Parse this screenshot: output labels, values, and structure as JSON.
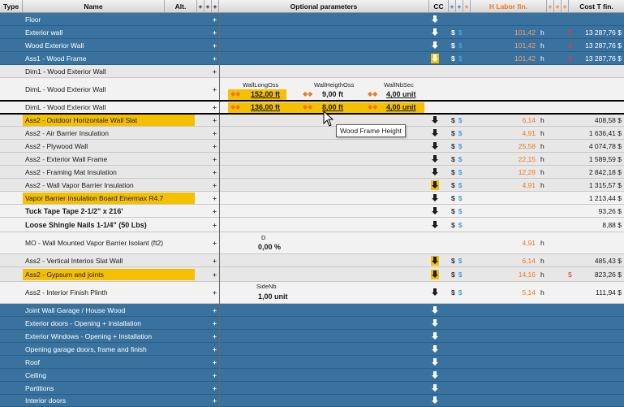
{
  "columns": {
    "type": "Type",
    "name": "Name",
    "alt": "Alt.",
    "plus": "+",
    "optional": "Optional parameters",
    "cc": "CC",
    "h_labor": "H Labor fin.",
    "cost": "Cost T fin."
  },
  "rows": [
    {
      "name": "Floor",
      "style": "blue",
      "plus": "+",
      "cc": true
    },
    {
      "name": "Exterior wall",
      "style": "blue",
      "plus": "+",
      "cc": true,
      "money": "$",
      "money2": "$",
      "h": "101,42",
      "hunit": "h",
      "dol": "$",
      "cost": "13 287,76 $"
    },
    {
      "name": "Wood Exterior Wall",
      "style": "blue",
      "plus": "+",
      "cc": true,
      "money": "$",
      "money2": "$",
      "h": "101,42",
      "hunit": "h",
      "dol": "$",
      "cost": "13 287,76 $"
    },
    {
      "name": "Ass1 - Wood Frame",
      "style": "blue",
      "plus": "+",
      "cc": true,
      "money": "$",
      "money2": "$",
      "h": "101,42",
      "hunit": "h",
      "dol": "$",
      "cost": "13 287,76 $"
    },
    {
      "name": "Dim1 - Wood Exterior Wall",
      "style": "grey",
      "plus": "+"
    },
    {
      "name": "DimL - Wood Exterior Wall",
      "style": "light",
      "plus": "+"
    },
    {
      "name": "DimL - Wood Exterior Wall",
      "style": "light",
      "plus": "+"
    },
    {
      "name": "Ass2 - Outdoor Horizontale Wall Slat",
      "style": "grey",
      "highlight": true,
      "plus": "+",
      "money": "$",
      "money2": "$",
      "h": "6,14",
      "hunit": "h",
      "cost": "408,58 $"
    },
    {
      "name": "Ass2 - Air Barrier Insulation",
      "style": "grey",
      "plus": "+",
      "money": "$",
      "money2": "$",
      "h": "4,91",
      "hunit": "h",
      "cost": "1 636,41 $"
    },
    {
      "name": "Ass2 - Plywood Wall",
      "style": "grey",
      "plus": "+",
      "money": "$",
      "money2": "$",
      "h": "25,58",
      "hunit": "h",
      "cost": "4 074,78 $"
    },
    {
      "name": "Ass2 - Exterior Wall Frame",
      "style": "grey",
      "plus": "+",
      "money": "$",
      "money2": "$",
      "h": "22,15",
      "hunit": "h",
      "cost": "1 589,59 $"
    },
    {
      "name": "Ass2 - Framing Mat Insulation",
      "style": "grey",
      "plus": "+",
      "money": "$",
      "money2": "$",
      "h": "12,28",
      "hunit": "h",
      "cost": "2 842,18 $"
    },
    {
      "name": "Ass2 - Wall Vapor Barrier Insulation",
      "style": "grey",
      "plus": "+",
      "money": "$",
      "money2": "$",
      "h": "4,91",
      "hunit": "h",
      "cost": "1 315,57 $"
    },
    {
      "name": "Vapor Barrier Insulation Board Enermax R4.7",
      "style": "light",
      "highlight": true,
      "plus": "+",
      "money": "$",
      "money2": "$",
      "cost": "1 213,44 $"
    },
    {
      "name": "Tuck Tape Tape   2-1/2\" x 216'",
      "style": "light",
      "bold": true,
      "plus": "+",
      "money": "$",
      "money2": "$",
      "cost": "93,26 $"
    },
    {
      "name": "Loose Shingle Nails   1-1/4\" (50 Lbs)",
      "style": "light",
      "bold": true,
      "plus": "+",
      "money": "$",
      "money2": "$",
      "cost": "8,88 $"
    },
    {
      "name": "MO - Wall Mounted Vapor Barrier Isolant (ft2)",
      "style": "light",
      "plus": "+",
      "h": "4,91",
      "hunit": "h"
    },
    {
      "name": "Ass2 - Vertical Interios Slat Wall",
      "style": "grey",
      "plus": "+",
      "money": "$",
      "money2": "$",
      "h": "6,14",
      "hunit": "h",
      "cost": "485,43 $"
    },
    {
      "name": "Ass2 - Gypsum and joints",
      "style": "grey",
      "highlight": true,
      "plus": "+",
      "money": "$",
      "money2": "$",
      "h": "14,16",
      "hunit": "h",
      "dol": "$",
      "cost": "823,26 $"
    },
    {
      "name": "Ass2 - Interior Finish Plinth",
      "style": "light",
      "plus": "+",
      "money": "$",
      "money2": "$",
      "h": "5,14",
      "hunit": "h",
      "cost": "111,94 $"
    },
    {
      "name": "Joint Wall Garage / House Wood",
      "style": "blue",
      "plus": "+",
      "cc": true
    },
    {
      "name": "Exterior doors - Opening + Installation",
      "style": "blue",
      "plus": "+",
      "cc": true
    },
    {
      "name": "Exterior Windows - Opening + Installation",
      "style": "blue",
      "plus": "+",
      "cc": true
    },
    {
      "name": "Opening garage doors, frame and finish",
      "style": "blue",
      "plus": "+",
      "cc": true
    },
    {
      "name": "Roof",
      "style": "blue",
      "plus": "+",
      "cc": true
    },
    {
      "name": "Ceiling",
      "style": "blue",
      "plus": "+",
      "cc": true
    },
    {
      "name": "Partitions",
      "style": "blue",
      "plus": "+",
      "cc": true
    },
    {
      "name": "Interior doors",
      "style": "blue",
      "plus": "+",
      "cc": true
    }
  ],
  "optional": {
    "label1": "WallLongOss",
    "label2": "WallHeigthOss",
    "label3": "WallNbSec",
    "r1_v1": "152,00 ft",
    "r1_v2": "9,00 ft",
    "r1_v3": "4,00 unit",
    "r2_v1": "136,00 ft",
    "r2_v2": "8,00 ft",
    "r2_v3": "4,00 unit",
    "d_label": "D",
    "d_value": "0,00 %",
    "side_label": "SideNb",
    "side_value": "1,00 unit"
  },
  "tooltip": "Wood Frame Height"
}
